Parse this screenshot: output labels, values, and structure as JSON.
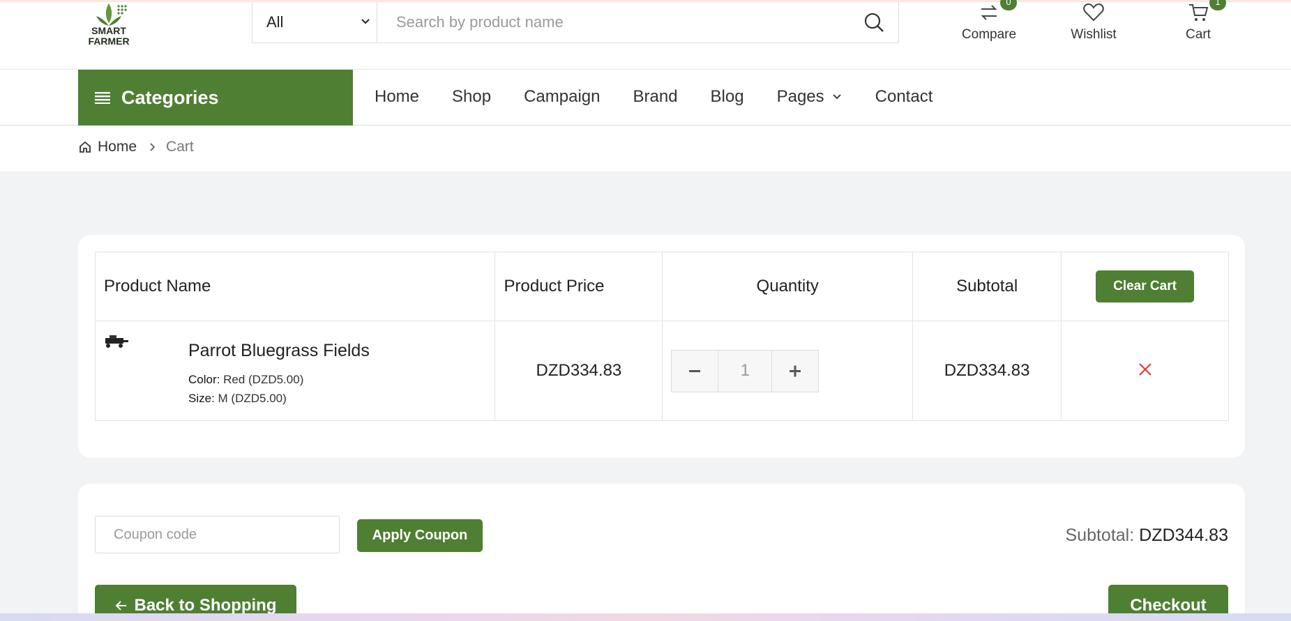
{
  "brand": {
    "logo_text_line1": "SMART",
    "logo_text_line2": "FARMER",
    "accent_color": "#4e7f32"
  },
  "search": {
    "category": "All",
    "placeholder": "Search by product name"
  },
  "header_actions": {
    "compare": {
      "label": "Compare",
      "count": "0"
    },
    "wishlist": {
      "label": "Wishlist"
    },
    "cart": {
      "label": "Cart",
      "count": "1"
    }
  },
  "nav": {
    "categories_label": "Categories",
    "links": [
      "Home",
      "Shop",
      "Campaign",
      "Brand",
      "Blog",
      "Pages",
      "Contact"
    ]
  },
  "breadcrumb": {
    "home": "Home",
    "current": "Cart"
  },
  "cart_table": {
    "headers": {
      "product_name": "Product Name",
      "product_price": "Product Price",
      "quantity": "Quantity",
      "subtotal": "Subtotal"
    },
    "clear_label": "Clear Cart",
    "items": [
      {
        "name": "Parrot Bluegrass Fields",
        "color_label": "Color:",
        "color_value": "Red (DZD5.00)",
        "size_label": "Size:",
        "size_value": "M (DZD5.00)",
        "price": "DZD334.83",
        "quantity": "1",
        "subtotal": "DZD334.83"
      }
    ]
  },
  "coupon": {
    "placeholder": "Coupon code",
    "apply_label": "Apply Coupon"
  },
  "summary": {
    "subtotal_label": "Subtotal:",
    "subtotal_value": "DZD344.83"
  },
  "actions": {
    "back_label": "Back to Shopping",
    "checkout_label": "Checkout"
  }
}
